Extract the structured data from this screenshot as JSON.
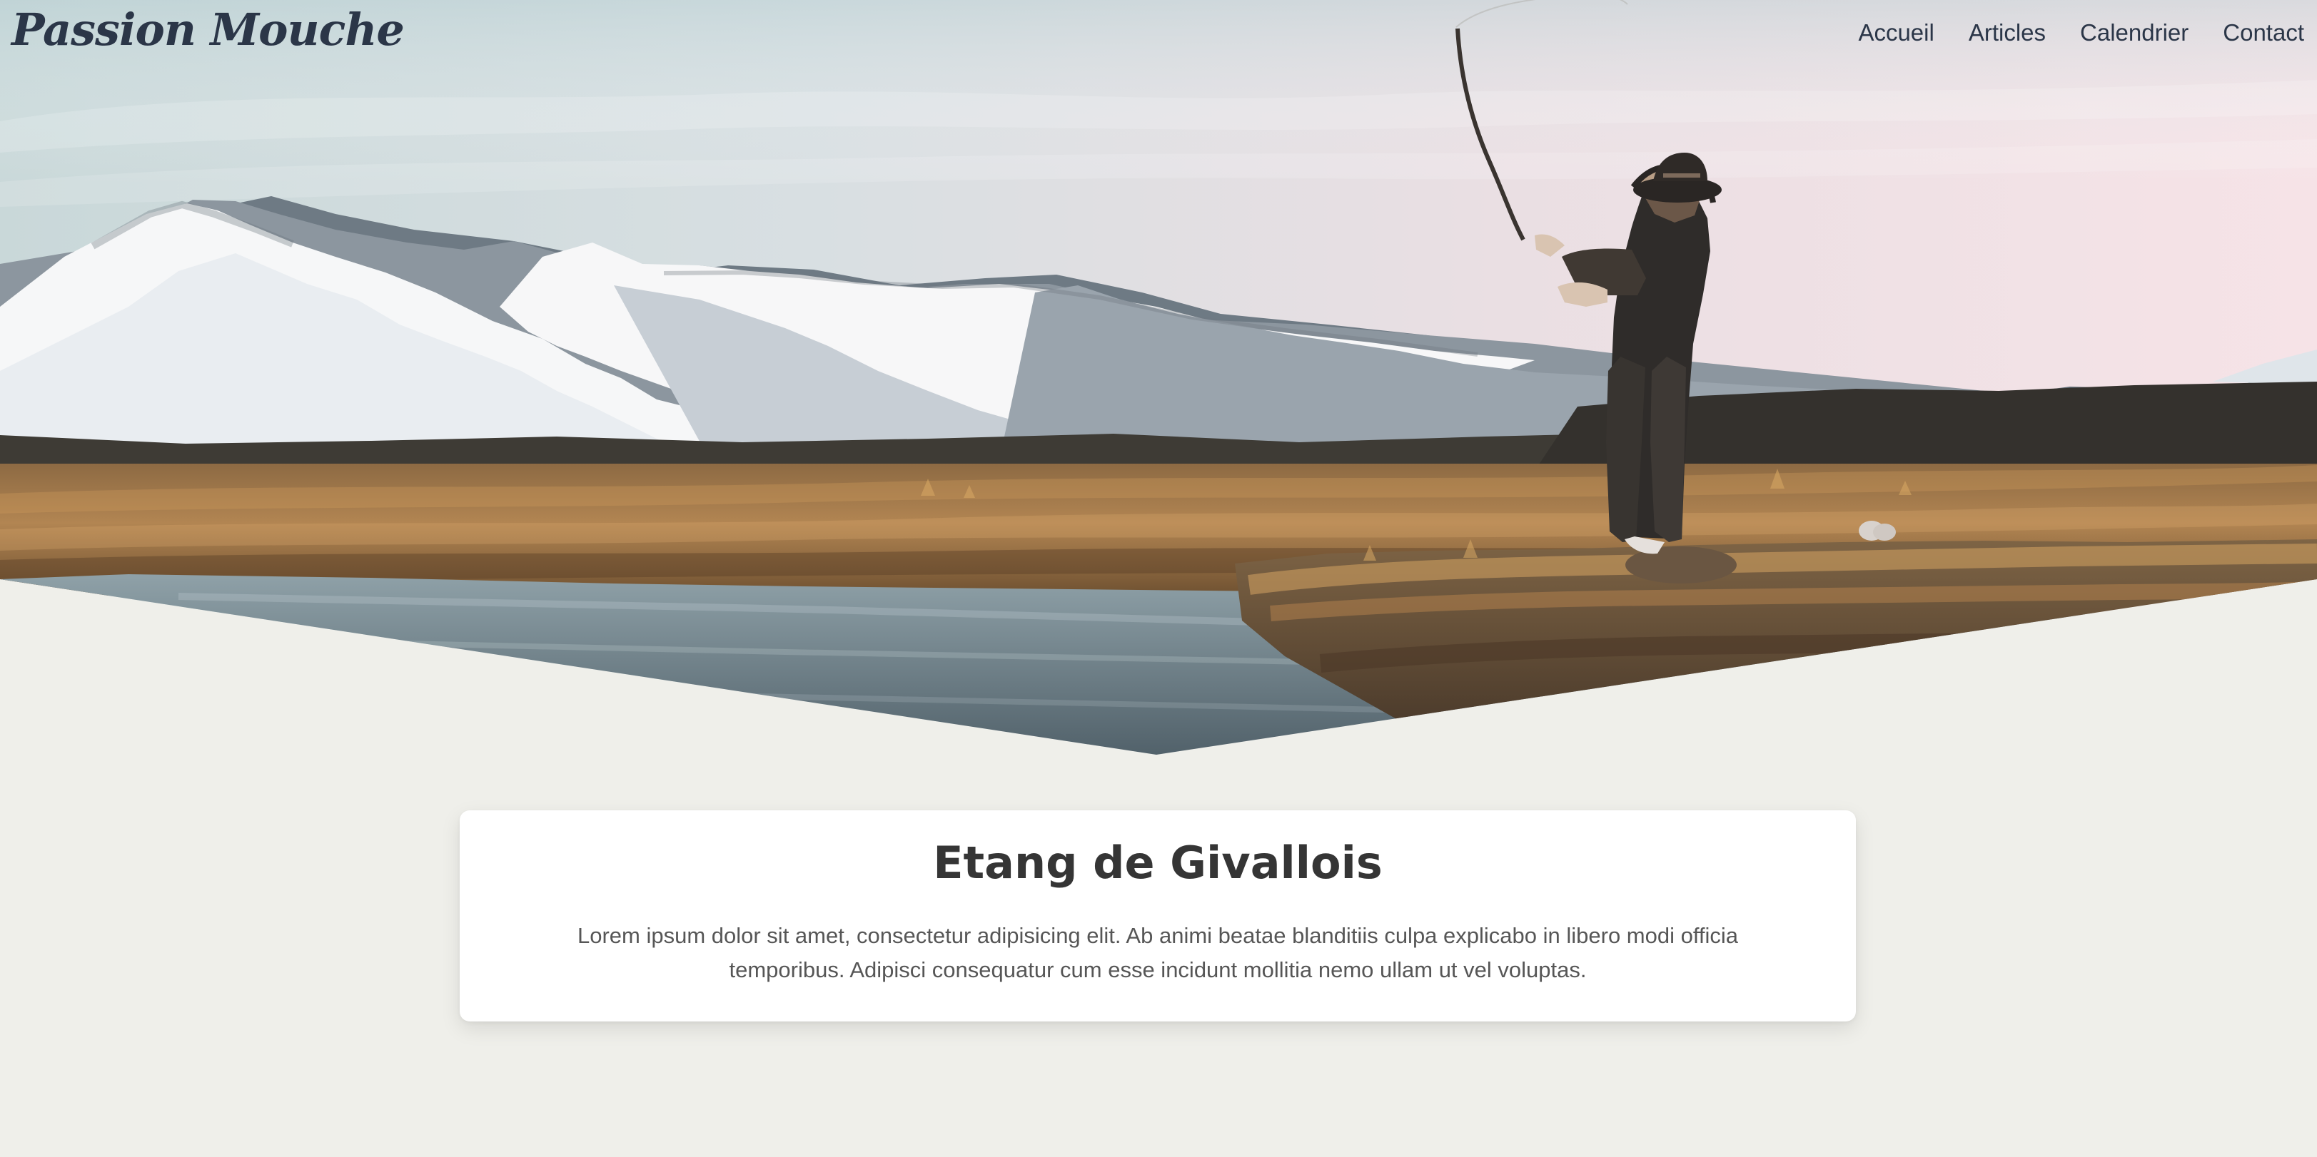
{
  "site": {
    "brand": "Passion Mouche"
  },
  "nav": {
    "items": [
      {
        "label": "Accueil"
      },
      {
        "label": "Articles"
      },
      {
        "label": "Calendrier"
      },
      {
        "label": "Contact"
      }
    ]
  },
  "hero": {
    "image_subject": "fly fisherman casting in mountain landscape"
  },
  "article": {
    "title": "Etang de Givallois",
    "description": "Lorem ipsum dolor sit amet, consectetur adipisicing elit. Ab animi beatae blanditiis culpa explicabo in libero modi officia temporibus. Adipisci consequatur cum esse incidunt mollitia nemo ullam ut vel voluptas."
  },
  "colors": {
    "text_dark": "#2b3648",
    "page_bg": "#efefea",
    "card_bg": "#ffffff",
    "title_text": "#353535",
    "body_text": "#565656"
  }
}
